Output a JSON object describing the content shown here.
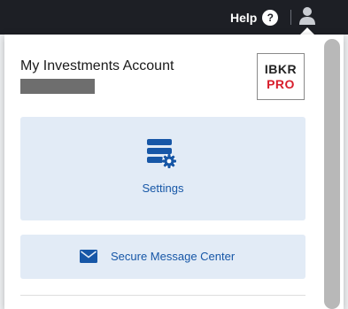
{
  "topbar": {
    "help_label": "Help",
    "help_icon_glyph": "?"
  },
  "account": {
    "title": "My Investments Account"
  },
  "logo": {
    "line1": "IBKR",
    "line2": "PRO"
  },
  "settings_tile": {
    "label": "Settings",
    "icon": "settings-gear-icon"
  },
  "message_center": {
    "label": "Secure Message Center",
    "icon": "mail-icon"
  },
  "colors": {
    "topbar_bg": "#1d1f25",
    "accent_blue": "#1757a7",
    "tile_bg": "#e2ebf6",
    "logo_red": "#d81e2c"
  }
}
